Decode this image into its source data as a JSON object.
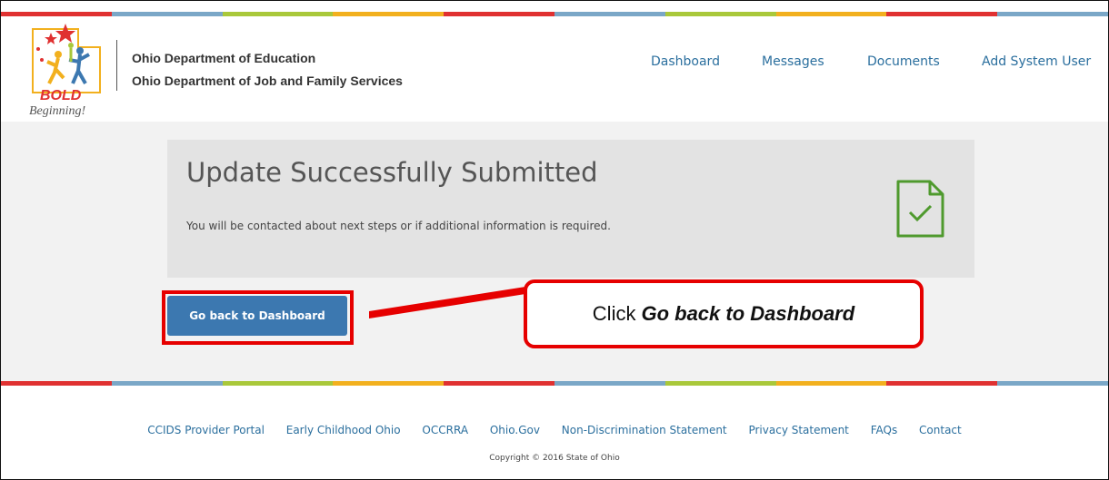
{
  "header": {
    "logo_text_line1": "BOLD",
    "logo_text_line2": "Beginning!",
    "org_line1": "Ohio Department of Education",
    "org_line2": "Ohio Department of Job and Family Services",
    "nav": [
      "Dashboard",
      "Messages",
      "Documents",
      "Add System User"
    ]
  },
  "stripe_colors": [
    "#e03131",
    "#7aa7c7",
    "#a9c83a",
    "#f2b01e",
    "#e03131",
    "#7aa7c7",
    "#a9c83a",
    "#f2b01e",
    "#e03131",
    "#7aa7c7"
  ],
  "alert": {
    "title": "Update Successfully Submitted",
    "message": "You will be contacted about next steps or if additional information is required.",
    "icon": "document-check-icon",
    "icon_color": "#4f9a2e"
  },
  "actions": {
    "back_button": "Go back to Dashboard"
  },
  "callout": {
    "prefix": "Click",
    "emphasis": "Go back to Dashboard"
  },
  "footer": {
    "links": [
      "CCIDS Provider Portal",
      "Early Childhood Ohio",
      "OCCRRA",
      "Ohio.Gov",
      "Non-Discrimination Statement",
      "Privacy Statement",
      "FAQs",
      "Contact"
    ],
    "copyright": "Copyright © 2016 State of Ohio"
  },
  "colors": {
    "link": "#2b6f9e",
    "button": "#3c78b0",
    "highlight": "#e60000"
  }
}
